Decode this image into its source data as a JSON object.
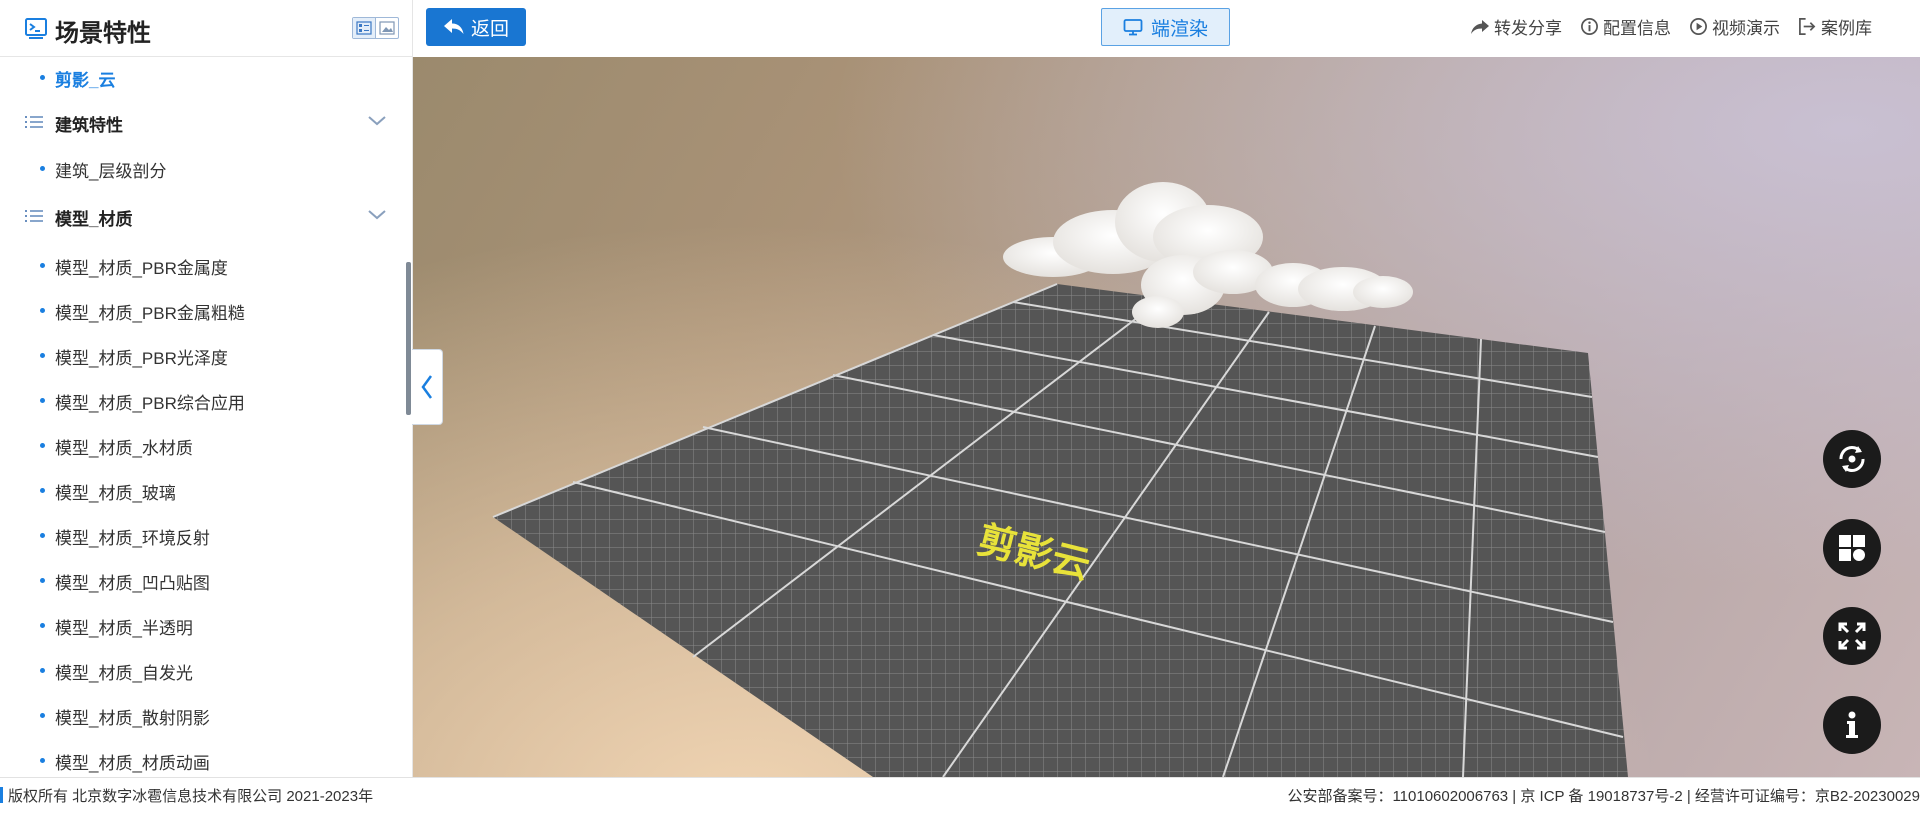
{
  "sidebar": {
    "title": "场景特性",
    "icons": {
      "title": "console-icon",
      "view_list": "list-view-icon",
      "view_card": "card-view-icon"
    },
    "rows": [
      {
        "kind": "leaf",
        "label": "剪影_云",
        "active": true
      },
      {
        "kind": "group",
        "label": "建筑特性",
        "expanded": true
      },
      {
        "kind": "leaf",
        "label": "建筑_层级剖分",
        "active": false
      },
      {
        "kind": "group",
        "label": "模型_材质",
        "expanded": true
      },
      {
        "kind": "leaf",
        "label": "模型_材质_PBR金属度",
        "active": false
      },
      {
        "kind": "leaf",
        "label": "模型_材质_PBR金属粗糙",
        "active": false
      },
      {
        "kind": "leaf",
        "label": "模型_材质_PBR光泽度",
        "active": false
      },
      {
        "kind": "leaf",
        "label": "模型_材质_PBR综合应用",
        "active": false
      },
      {
        "kind": "leaf",
        "label": "模型_材质_水材质",
        "active": false
      },
      {
        "kind": "leaf",
        "label": "模型_材质_玻璃",
        "active": false
      },
      {
        "kind": "leaf",
        "label": "模型_材质_环境反射",
        "active": false
      },
      {
        "kind": "leaf",
        "label": "模型_材质_凹凸贴图",
        "active": false
      },
      {
        "kind": "leaf",
        "label": "模型_材质_半透明",
        "active": false
      },
      {
        "kind": "leaf",
        "label": "模型_材质_自发光",
        "active": false
      },
      {
        "kind": "leaf",
        "label": "模型_材质_散射阴影",
        "active": false
      },
      {
        "kind": "leaf",
        "label": "模型_材质_材质动画",
        "active": false
      }
    ]
  },
  "toolbar": {
    "back_label": "返回",
    "render_label": "端渲染",
    "links": [
      {
        "label": "转发分享",
        "icon": "share-icon"
      },
      {
        "label": "配置信息",
        "icon": "info-circle-icon"
      },
      {
        "label": "视频演示",
        "icon": "play-circle-icon"
      },
      {
        "label": "案例库",
        "icon": "exit-icon"
      }
    ]
  },
  "scene": {
    "ground_text": "剪影云",
    "controls": [
      {
        "name": "rotate-view-button",
        "icon": "rotate-icon"
      },
      {
        "name": "layers-button",
        "icon": "tiles-icon"
      },
      {
        "name": "fullscreen-button",
        "icon": "expand-icon"
      },
      {
        "name": "info-button",
        "icon": "info-icon"
      }
    ]
  },
  "footer": {
    "copyright": "版权所有 北京数字冰雹信息技术有限公司 2021-2023年",
    "license": "公安部备案号：11010602006763 | 京 ICP 备 19018737号-2 | 经营许可证编号：京B2-20230029"
  },
  "colors": {
    "accent": "#1976d2",
    "link_blue": "#1a7fe0",
    "control_bg": "#1b1b1b",
    "ground": "#5a5a5a",
    "ground_text": "#e8e23a"
  }
}
